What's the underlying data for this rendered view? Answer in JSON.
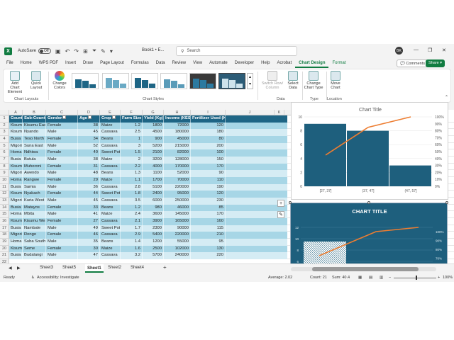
{
  "titlebar": {
    "autosave_label": "AutoSave",
    "autosave_state": "Off",
    "book_title": "Book1 • E...",
    "search_placeholder": "Search",
    "avatar_initials": "BK"
  },
  "menu_tabs": [
    "File",
    "Home",
    "WPS PDF",
    "Insert",
    "Draw",
    "Page Layout",
    "Formulas",
    "Data",
    "Review",
    "View",
    "Automate",
    "Developer",
    "Help",
    "Acrobat",
    "Chart Design",
    "Format"
  ],
  "actions": {
    "comments": "Comments",
    "share": "Share"
  },
  "ribbon": {
    "add_chart_element": "Add Chart Element",
    "quick_layout": "Quick Layout",
    "change_colors": "Change Colors",
    "chart_layouts_label": "Chart Layouts",
    "chart_styles_label": "Chart Styles",
    "switch_row_column": "Switch Row/ Column",
    "select_data": "Select Data",
    "data_label": "Data",
    "change_chart_type": "Change Chart Type",
    "type_label": "Type",
    "move_chart": "Move Chart",
    "location_label": "Location"
  },
  "grid": {
    "column_letters": [
      "A",
      "B",
      "C",
      "D",
      "E",
      "F",
      "G",
      "H",
      "I",
      "J",
      "K",
      "L",
      "M",
      "N",
      "O",
      "P",
      "Q"
    ],
    "row_numbers": [
      "1",
      "2",
      "3",
      "4",
      "5",
      "6",
      "7",
      "8",
      "9",
      "10",
      "11",
      "12",
      "13",
      "14",
      "15",
      "16",
      "17",
      "18",
      "19",
      "20",
      "21",
      "22",
      "23"
    ],
    "headers": [
      "County",
      "Sub-County",
      "Gender",
      "Age",
      "Crop",
      "Farm Size (Acres)",
      "Yield (Kg)",
      "Income (KES)",
      "Fertilizer Used (Kg)"
    ],
    "rows": [
      [
        "Kisumu",
        "Kisumu East",
        "Female",
        "38",
        "Maize",
        "1.2",
        "1800",
        "72000",
        "120"
      ],
      [
        "Kisumu",
        "Nyando",
        "Male",
        "45",
        "Cassava",
        "2.5",
        "4500",
        "180000",
        "180"
      ],
      [
        "Busia",
        "Teso North",
        "Female",
        "34",
        "Beans",
        "1",
        "900",
        "45000",
        "80"
      ],
      [
        "Migori",
        "Suna East",
        "Male",
        "52",
        "Cassava",
        "3",
        "5200",
        "215000",
        "200"
      ],
      [
        "Homa Bay",
        "Ndhiwa",
        "Female",
        "40",
        "Sweet Pot",
        "1.5",
        "2100",
        "82000",
        "100"
      ],
      [
        "Busia",
        "Butula",
        "Male",
        "38",
        "Maize",
        "2",
        "3200",
        "128000",
        "150"
      ],
      [
        "Kisumu",
        "Muhoroni",
        "Female",
        "31",
        "Cassava",
        "2.2",
        "4000",
        "170000",
        "170"
      ],
      [
        "Migori",
        "Awendo",
        "Male",
        "48",
        "Beans",
        "1.3",
        "1100",
        "52000",
        "90"
      ],
      [
        "Homa Bay",
        "Rangwe",
        "Female",
        "29",
        "Maize",
        "1.1",
        "1700",
        "70000",
        "110"
      ],
      [
        "Busia",
        "Samia",
        "Male",
        "36",
        "Cassava",
        "2.8",
        "5100",
        "220000",
        "190"
      ],
      [
        "Kisumu",
        "Nyakach",
        "Female",
        "44",
        "Sweet Pot",
        "1.8",
        "2400",
        "95000",
        "120"
      ],
      [
        "Migori",
        "Kuria West",
        "Male",
        "45",
        "Cassava",
        "3.5",
        "6000",
        "250000",
        "230"
      ],
      [
        "Busia",
        "Matayos",
        "Female",
        "33",
        "Beans",
        "1.2",
        "980",
        "46000",
        "85"
      ],
      [
        "Homa Bay",
        "Mbita",
        "Male",
        "41",
        "Maize",
        "2.4",
        "3600",
        "145000",
        "170"
      ],
      [
        "Kisumu",
        "Kisumu West",
        "Female",
        "27",
        "Cassava",
        "2.1",
        "3900",
        "165000",
        "160"
      ],
      [
        "Busia",
        "Nambale",
        "Male",
        "49",
        "Sweet Pot",
        "1.7",
        "2300",
        "90000",
        "115"
      ],
      [
        "Migori",
        "Rongo",
        "Female",
        "46",
        "Cassava",
        "2.9",
        "5400",
        "220000",
        "210"
      ],
      [
        "Homa Bay",
        "Suba South",
        "Male",
        "35",
        "Beans",
        "1.4",
        "1200",
        "55000",
        "95"
      ],
      [
        "Kisumu",
        "Seme",
        "Female",
        "30",
        "Maize",
        "1.6",
        "2500",
        "102000",
        "130"
      ],
      [
        "Busia",
        "Budalangi",
        "Male",
        "47",
        "Cassava",
        "3.2",
        "5700",
        "240000",
        "220"
      ]
    ]
  },
  "chart_data": [
    {
      "type": "bar",
      "title": "Chart Title",
      "categories": [
        "[27, 37]",
        "(37, 47]",
        "(47, 57]"
      ],
      "values": [
        9,
        8,
        3
      ],
      "cumulative_percent": [
        45,
        85,
        100
      ],
      "ylim": [
        0,
        10
      ],
      "y_ticks": [
        "0",
        "2",
        "4",
        "6",
        "8",
        "10"
      ],
      "y2_ticks": [
        "0%",
        "10%",
        "20%",
        "30%",
        "40%",
        "50%",
        "60%",
        "70%",
        "80%",
        "90%",
        "100%"
      ],
      "colors": {
        "bar": "#1e5f7d",
        "line": "#ed7d31"
      }
    },
    {
      "type": "bar",
      "title": "CHART TITLE",
      "y_ticks": [
        "6",
        "8",
        "10",
        "12"
      ],
      "y2_ticks": [
        "60%",
        "70%",
        "80%",
        "90%",
        "100%"
      ],
      "colors": {
        "background": "#1e5f7d",
        "line": "#ed7d31"
      }
    }
  ],
  "sheet_tabs": [
    "Sheet3",
    "Sheet5",
    "Sheet1",
    "Sheet2",
    "Sheet4"
  ],
  "active_sheet": "Sheet1",
  "status": {
    "ready": "Ready",
    "accessibility": "Accessibility: Investigate",
    "average": "Average: 2.02",
    "count": "Count: 21",
    "sum": "Sum: 40.4",
    "zoom": "100%"
  }
}
